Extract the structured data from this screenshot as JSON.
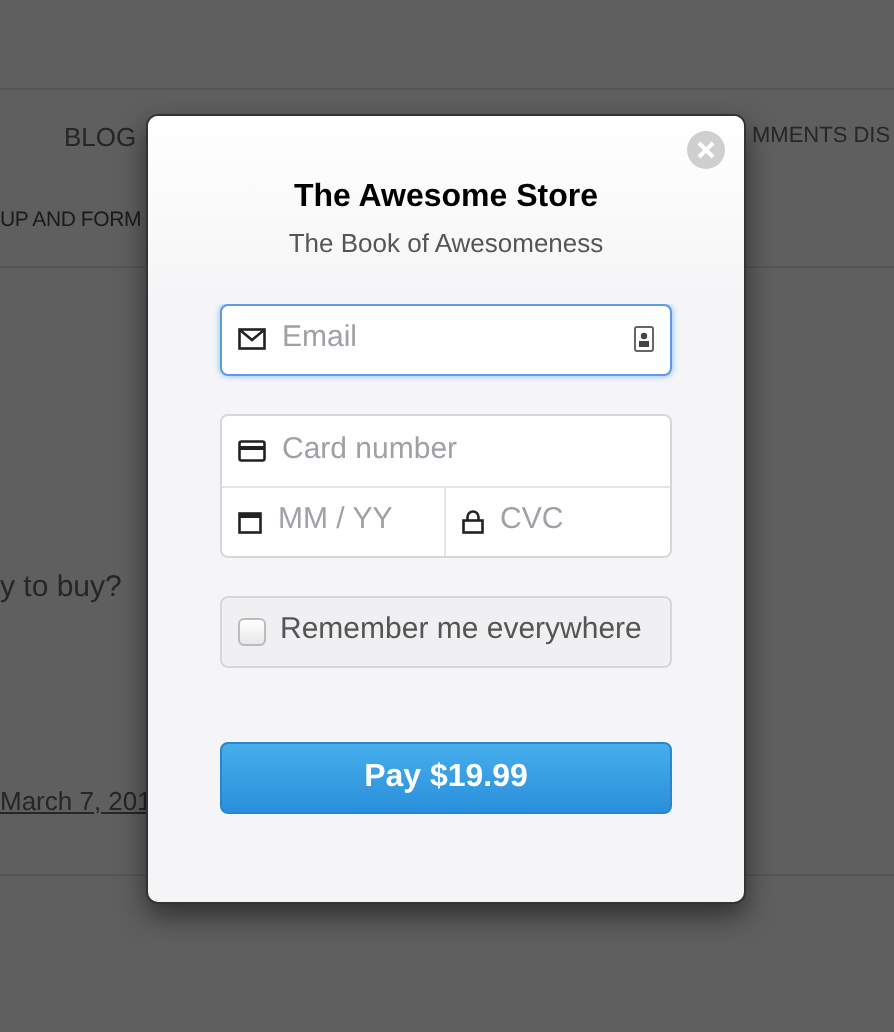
{
  "background": {
    "nav_items": [
      "BLOG",
      "MMENTS DIS"
    ],
    "subnav_item": "UP AND FORM",
    "question": "y to buy?",
    "date_link": "March 7, 201"
  },
  "checkout": {
    "title": "The Awesome Store",
    "subtitle": "The Book of Awesomeness",
    "email": {
      "placeholder": "Email",
      "focused": true
    },
    "card_number": {
      "placeholder": "Card number"
    },
    "expiry": {
      "placeholder": "MM / YY"
    },
    "cvc": {
      "placeholder": "CVC"
    },
    "remember": {
      "label": "Remember me everywhere",
      "checked": false
    },
    "pay_button": "Pay $19.99"
  }
}
